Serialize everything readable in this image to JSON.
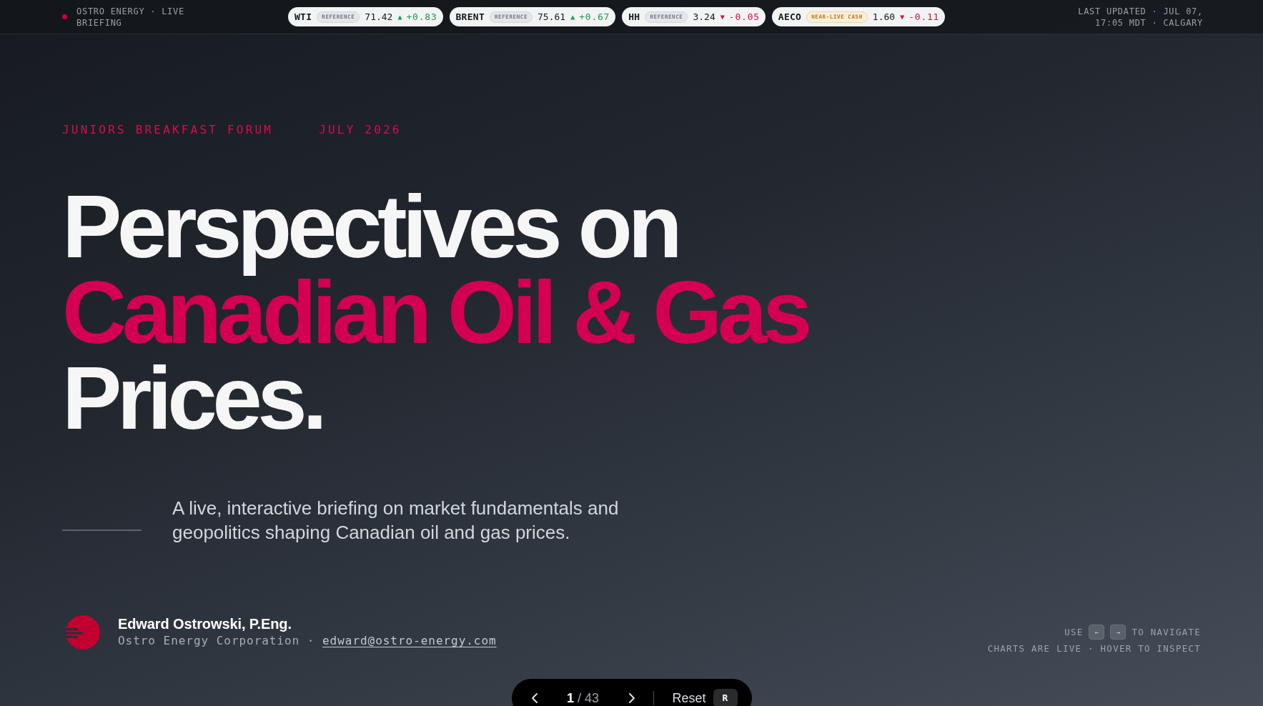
{
  "header": {
    "brand": "OSTRO ENERGY · LIVE BRIEFING",
    "tickers": [
      {
        "symbol": "WTI",
        "tag": {
          "label": "REFERENCE",
          "kind": "reference"
        },
        "price": "71.42",
        "arrow": "▲",
        "change": "+0.83",
        "color": "#1c9a4c"
      },
      {
        "symbol": "BRENT",
        "tag": {
          "label": "REFERENCE",
          "kind": "reference"
        },
        "price": "75.61",
        "arrow": "▲",
        "change": "+0.67",
        "color": "#1c9a4c"
      },
      {
        "symbol": "HH",
        "tag": {
          "label": "REFERENCE",
          "kind": "reference"
        },
        "price": "3.24",
        "arrow": "▼",
        "change": "-0.05",
        "color": "#cf0f3e"
      },
      {
        "symbol": "AECO",
        "tag": {
          "label": "NEAR-LIVE CASH",
          "kind": "near_live"
        },
        "price": "1.60",
        "arrow": "▼",
        "change": "-0.11",
        "color": "#cf0f3e"
      }
    ],
    "last_updated": "LAST UPDATED · JUL 07, 17:05 MDT · CALGARY"
  },
  "hero": {
    "event": "JUNIORS BREAKFAST FORUM",
    "date": "JULY 2026",
    "title_lines": [
      {
        "text": "Perspectives on",
        "accent": false
      },
      {
        "text": "Canadian Oil & Gas",
        "accent": true
      },
      {
        "text": "Prices.",
        "accent": false
      }
    ],
    "subtitle": "A live, interactive briefing on market fundamentals and geopolitics shaping Canadian oil and gas prices."
  },
  "author": {
    "name": "Edward Ostrowski, P.Eng.",
    "company": "Ostro Energy Corporation",
    "separator": "·",
    "email": "edward@ostro-energy.com"
  },
  "hints": {
    "navigate_before": "USE",
    "keys": [
      "←",
      "→"
    ],
    "navigate_after": "TO NAVIGATE",
    "charts": "CHARTS ARE LIVE · HOVER TO INSPECT"
  },
  "pager": {
    "current": "1",
    "separator": "/",
    "total": "43",
    "reset": "Reset",
    "reset_key": "R"
  }
}
